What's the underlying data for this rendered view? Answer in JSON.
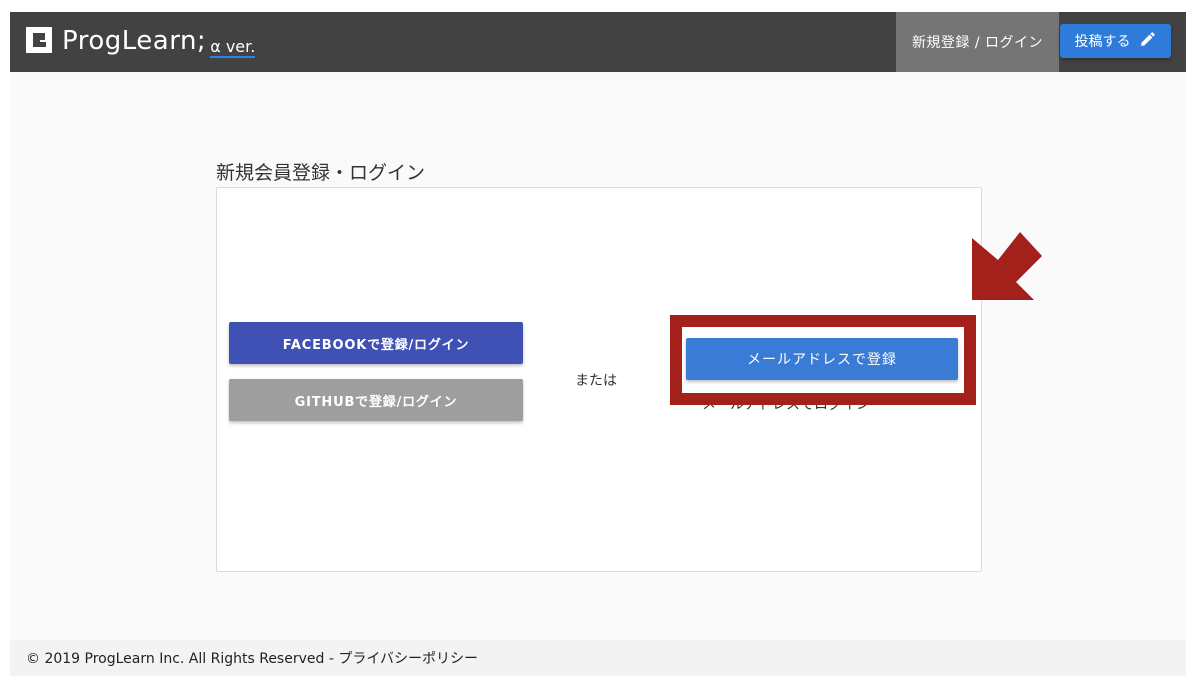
{
  "header": {
    "logo_text": "ProgLearn;",
    "logo_version": "α ver.",
    "login_link": "新規登録 / ログイン",
    "post_button": "投稿する",
    "post_icon": "pencil-icon"
  },
  "main": {
    "title": "新規会員登録・ログイン",
    "facebook_button": "FACEBOOKで登録/ログイン",
    "github_button": "GITHUBで登録/ログイン",
    "or_text": "または",
    "email_register_button": "メールアドレスで登録",
    "email_login_link": "メールアドレスでログイン"
  },
  "annotation": {
    "highlight_color": "#a3211a",
    "arrow_icon": "arrow-down-left-icon"
  },
  "footer": {
    "copyright": "© 2019 ProgLearn Inc. All Rights Reserved - プライバシーポリシー"
  },
  "colors": {
    "header_bg": "#424242",
    "facebook": "#3f51b5",
    "github": "#9e9e9e",
    "email": "#3a7bd5",
    "post_button": "#2f7bd9"
  }
}
